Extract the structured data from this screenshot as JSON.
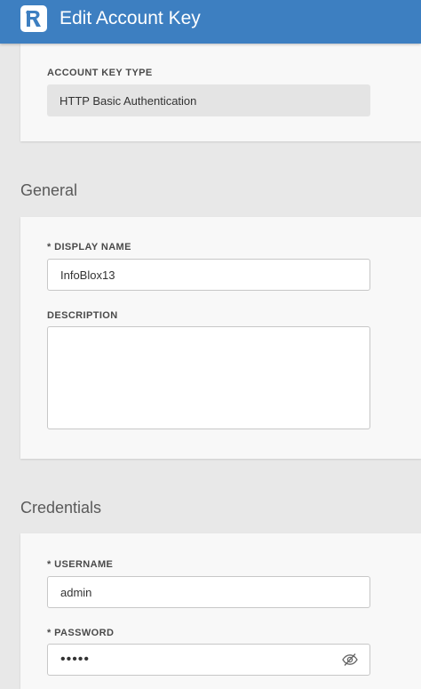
{
  "header": {
    "title": "Edit Account Key",
    "logo_icon": "account-key-app-icon",
    "background_color": "#3d7fc1"
  },
  "account_key_type": {
    "label": "ACCOUNT KEY TYPE",
    "value": "HTTP Basic Authentication"
  },
  "general": {
    "title": "General",
    "display_name": {
      "label": "* DISPLAY NAME",
      "value": "InfoBlox13"
    },
    "description": {
      "label": "DESCRIPTION",
      "value": ""
    }
  },
  "credentials": {
    "title": "Credentials",
    "username": {
      "label": "* USERNAME",
      "value": "admin"
    },
    "password": {
      "label": "* PASSWORD",
      "value": "•••••",
      "toggle_icon": "eye-slash-icon"
    }
  }
}
